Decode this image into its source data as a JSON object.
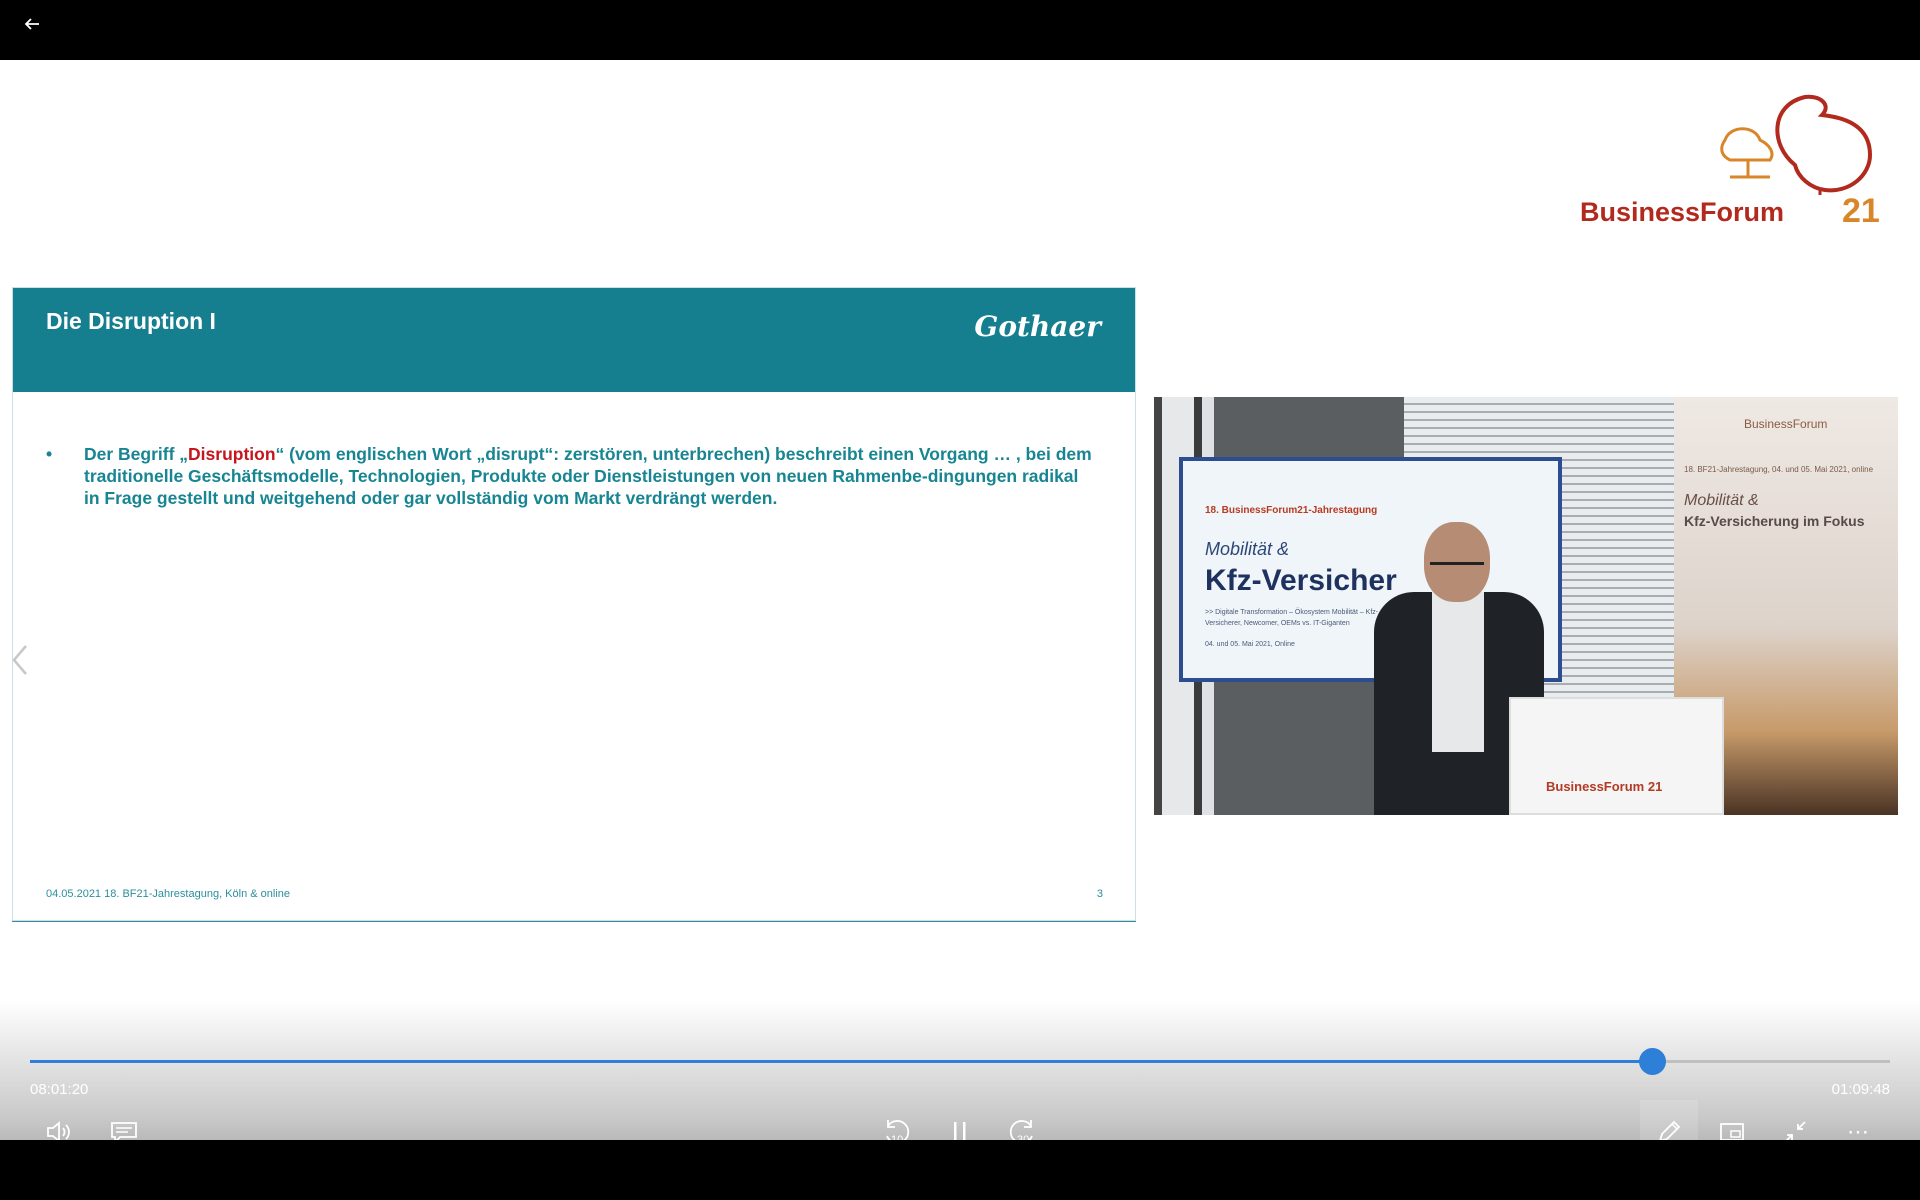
{
  "player": {
    "current_time": "08:01:20",
    "total_time": "01:09:48",
    "progress_fraction": 0.872
  },
  "overlay_logo": {
    "text": "BusinessForum",
    "number": "21"
  },
  "slide": {
    "title": "Die Disruption I",
    "brand": "Gothaer",
    "bullet": "•",
    "text_pre": "Der Begriff „",
    "text_highlight": "Disruption",
    "text_post": "“ (vom englischen Wort „disrupt“: zerstören, unterbrechen) beschreibt einen Vorgang … , bei dem traditionelle Geschäftsmodelle, Technologien, Produkte oder Dienstleistungen von neuen Rahmenbe-dingungen radikal in Frage gestellt und weitgehend oder gar vollständig vom Markt verdrängt werden.",
    "footer": "04.05.2021 18. BF21-Jahrestagung, Köln & online",
    "page": "3"
  },
  "camera": {
    "screen_line1": "18. BusinessForum21-Jahrestagung",
    "screen_line2": "Mobilität &",
    "screen_line3": "Kfz-Versicher",
    "screen_line4": ">> Digitale Transformation – Ökosystem Mobilität – Kfz-Versicherer, Newcomer, OEMs vs. IT-Giganten",
    "screen_line5": "04. und 05. Mai 2021, Online",
    "banner_logo": "BusinessForum",
    "banner_line1": "18. BF21-Jahrestagung, 04. und 05. Mai 2021, online",
    "banner_line2": "Mobilität &",
    "banner_line3": "Kfz-Versicherung im Fokus",
    "podium_text": "BusinessForum",
    "podium_num": "21"
  },
  "colors": {
    "accent": "#2d7fd8",
    "slide_header": "#167f8f",
    "slide_text": "#178592",
    "highlight": "#c5161d",
    "logo_red": "#b22a1e",
    "logo_orange": "#d8862a"
  },
  "icons": {
    "back": "back-arrow-icon",
    "volume": "volume-icon",
    "captions": "captions-icon",
    "rewind": "rewind-10-icon",
    "pause": "pause-icon",
    "forward": "forward-30-icon",
    "edit": "pencil-icon",
    "miniplayer": "miniplayer-icon",
    "exit_fullscreen": "exit-fullscreen-icon",
    "more": "more-icon",
    "prev": "chevron-left-icon"
  },
  "controls": {
    "rewind_label": "10",
    "forward_label": "30",
    "more_label": "⋯"
  }
}
